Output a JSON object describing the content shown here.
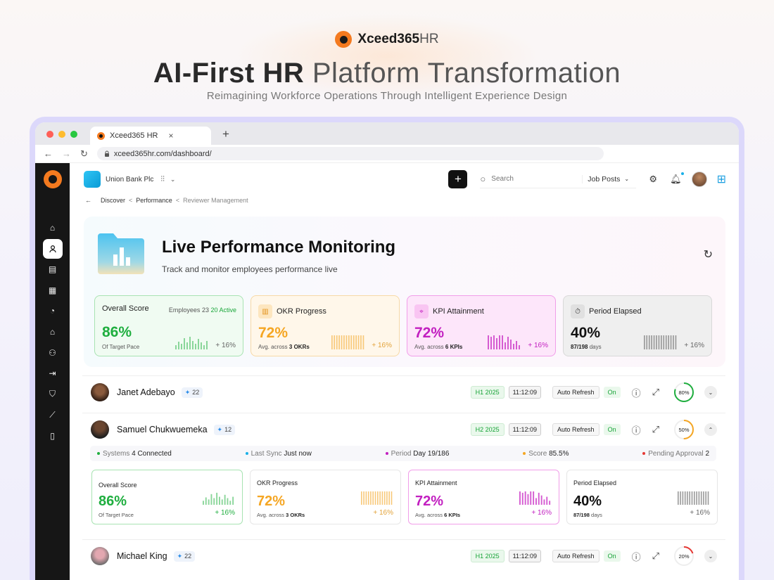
{
  "hero": {
    "brand_bold": "Xceed365",
    "brand_light": "HR",
    "title_bold": "AI-First HR",
    "title_light": "Platform Transformation",
    "subtitle": "Reimagining Workforce Operations Through Intelligent Experience Design"
  },
  "browser": {
    "tab_title": "Xceed365 HR",
    "url": "xceed365hr.com/dashboard/"
  },
  "topbar": {
    "org_name": "Union Bank Plc",
    "search_placeholder": "Search",
    "job_posts_label": "Job Posts"
  },
  "breadcrumb": {
    "items": [
      "Discover",
      "Performance",
      "Reviewer Management"
    ]
  },
  "page": {
    "title": "Live Performance Monitoring",
    "subtitle": "Track and monitor employees performance live"
  },
  "stats": {
    "overall": {
      "label": "Overall Score",
      "extra_label": "Employees",
      "employees": "23",
      "active": "20 Active",
      "value": "86%",
      "caption": "Of Target Pace",
      "delta": "+ 16%",
      "color": "#1fae3f"
    },
    "okr": {
      "label": "OKR Progress",
      "value": "72%",
      "caption_pre": "Avg. across",
      "caption_bold": "3 OKRs",
      "delta": "+ 16%",
      "color": "#f5a623"
    },
    "kpi": {
      "label": "KPI Attainment",
      "value": "72%",
      "caption_pre": "Avg. across",
      "caption_bold": "6 KPIs",
      "delta": "+ 16%",
      "color": "#c21fc0"
    },
    "period": {
      "label": "Period Elapsed",
      "value": "40%",
      "caption_bold": "87/198",
      "caption_post": "days",
      "delta": "+ 16%",
      "color": "#111111"
    }
  },
  "employees": [
    {
      "name": "Janet Adebayo",
      "badge": "22",
      "period": "H1 2025",
      "time": "11:12:09",
      "auto_refresh": "Auto Refresh",
      "on": "On",
      "progress": 80,
      "progress_label": "80%",
      "ring_color": "#1fae3f"
    },
    {
      "name": "Samuel Chukwuemeka",
      "badge": "12",
      "period": "H2 2025",
      "time": "11:12:09",
      "auto_refresh": "Auto Refresh",
      "on": "On",
      "progress": 50,
      "progress_label": "50%",
      "ring_color": "#f5a623"
    },
    {
      "name": "Michael King",
      "badge": "22",
      "period": "H1 2025",
      "time": "11:12:09",
      "auto_refresh": "Auto Refresh",
      "on": "On",
      "progress": 20,
      "progress_label": "20%",
      "ring_color": "#e53935"
    }
  ],
  "expanded": {
    "systems_label": "Systems",
    "systems_value": "4 Connected",
    "sync_label": "Last Sync",
    "sync_value": "Just now",
    "period_label": "Period",
    "period_value": "Day 19/186",
    "score_label": "Score",
    "score_value": "85.5%",
    "pending_label": "Pending Approval",
    "pending_value": "2",
    "cards": {
      "overall": {
        "label": "Overall Score",
        "value": "86%",
        "caption": "Of Target Pace",
        "delta": "+ 16%"
      },
      "okr": {
        "label": "OKR Progress",
        "value": "72%",
        "caption_pre": "Avg. across",
        "caption_bold": "3 OKRs",
        "delta": "+ 16%"
      },
      "kpi": {
        "label": "KPI Attainment",
        "value": "72%",
        "caption_pre": "Avg. across",
        "caption_bold": "6 KPIs",
        "delta": "+ 16%"
      },
      "period": {
        "label": "Period Elapsed",
        "value": "40%",
        "caption_bold": "87/198",
        "caption_post": "days",
        "delta": "+ 16%"
      }
    }
  },
  "colors": {
    "accent_orange": "#f47a1f",
    "green": "#1fae3f",
    "amber": "#f5a623",
    "magenta": "#c21fc0",
    "blue": "#1a9ee0"
  },
  "icons": {
    "sidebar": [
      "sparkle-icon",
      "home-icon",
      "user-icon",
      "id-card-icon",
      "grid-card-icon",
      "pie-chart-icon",
      "graduation-cap-icon",
      "user-gear-icon",
      "login-icon",
      "shield-icon",
      "line-chart-icon",
      "document-icon"
    ]
  }
}
